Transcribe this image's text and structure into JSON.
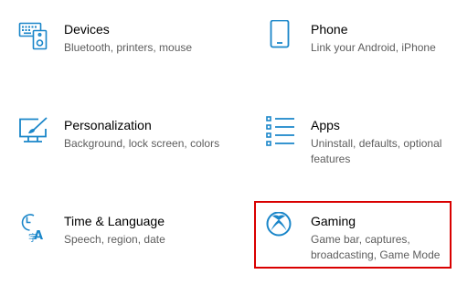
{
  "colors": {
    "accent": "#1a86c9",
    "title_text": "#000000",
    "description_text": "#5d5d5d",
    "selection_border": "#d90000"
  },
  "tiles": [
    {
      "title": "Devices",
      "description": "Bluetooth, printers, mouse",
      "icon": "devices-icon"
    },
    {
      "title": "Phone",
      "description": "Link your Android, iPhone",
      "icon": "phone-icon"
    },
    {
      "title": "Personalization",
      "description": "Background, lock screen, colors",
      "icon": "personalization-icon"
    },
    {
      "title": "Apps",
      "description": "Uninstall, defaults, optional features",
      "icon": "apps-icon"
    },
    {
      "title": "Time & Language",
      "description": "Speech, region, date",
      "icon": "time-language-icon"
    },
    {
      "title": "Gaming",
      "description": "Game bar, captures, broadcasting, Game Mode",
      "icon": "xbox-icon",
      "selected": true
    }
  ]
}
